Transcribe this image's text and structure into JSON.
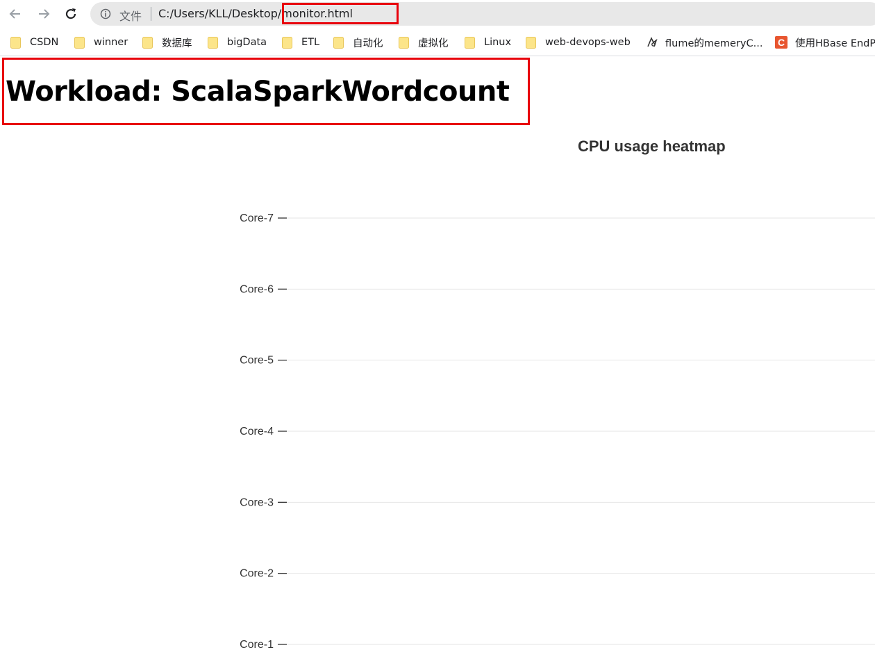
{
  "browser": {
    "nav": {
      "back_icon": "arrow-left-icon",
      "forward_icon": "arrow-right-icon",
      "reload_icon": "reload-icon"
    },
    "address_bar": {
      "scheme_label": "文件",
      "url": "C:/Users/KLL/Desktop/monitor.html",
      "highlight_color": "#e8000b"
    },
    "bookmarks": [
      {
        "label": "CSDN",
        "icon": "folder-icon"
      },
      {
        "label": "winner",
        "icon": "folder-icon"
      },
      {
        "label": "数据库",
        "icon": "folder-icon"
      },
      {
        "label": "bigData",
        "icon": "folder-icon"
      },
      {
        "label": "ETL",
        "icon": "folder-icon"
      },
      {
        "label": "自动化",
        "icon": "folder-icon"
      },
      {
        "label": "虚拟化",
        "icon": "folder-icon"
      },
      {
        "label": "Linux",
        "icon": "folder-icon"
      },
      {
        "label": "web-devops-web",
        "icon": "folder-icon"
      },
      {
        "label": "flume的memeryC...",
        "icon": "site-icon"
      },
      {
        "label": "使用HBase EndP",
        "icon": "csdn-icon"
      }
    ]
  },
  "page": {
    "title": "Workload: ScalaSparkWordcount",
    "title_highlight_color": "#e8000b"
  },
  "chart_data": {
    "type": "heatmap",
    "title": "CPU usage heatmap",
    "categories": [
      "Core-7",
      "Core-6",
      "Core-5",
      "Core-4",
      "Core-3",
      "Core-2",
      "Core-1"
    ],
    "values": [],
    "grid": true
  }
}
